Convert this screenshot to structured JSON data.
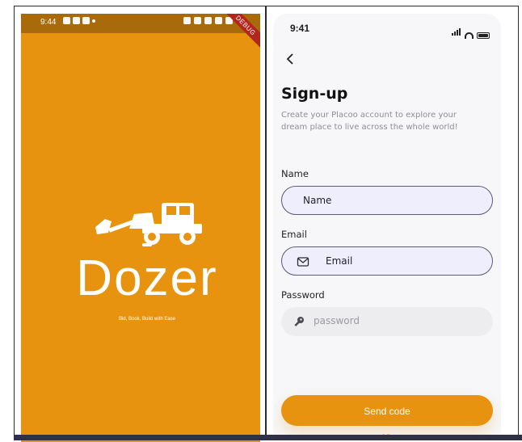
{
  "left_screen": {
    "status_time": "9:44",
    "debug_label": "DEBUG",
    "logo_text": "Dozer",
    "tagline": "Bid, Book, Build with Ease",
    "background_color": "#e8930f"
  },
  "right_screen": {
    "status_time": "9:41",
    "title": "Sign-up",
    "subtitle": "Create your Placoo account to explore your dream place to live across the whole world!",
    "fields": [
      {
        "label": "Name",
        "value": "Name"
      },
      {
        "label": "Email",
        "value": "Email",
        "icon": "mail-icon"
      },
      {
        "label": "Password",
        "placeholder": "password",
        "icon": "key-icon"
      }
    ],
    "send_button": "Send code",
    "or_text": "OR",
    "accent_color": "#e8930f"
  }
}
